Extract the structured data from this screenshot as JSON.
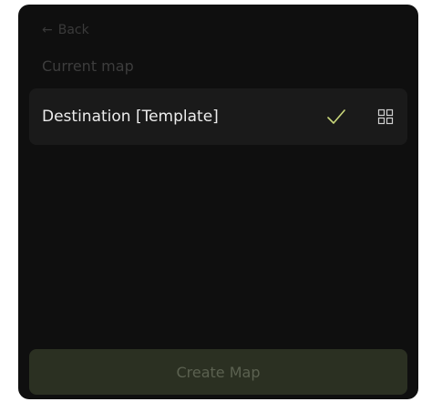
{
  "nav": {
    "back_arrow": "←",
    "back_label": "Back"
  },
  "section": {
    "title": "Current map"
  },
  "maps": [
    {
      "name": "Destination [Template]",
      "selected": true,
      "check_icon": "check-icon",
      "action_icon": "grid-icon"
    }
  ],
  "footer": {
    "create_label": "Create Map"
  },
  "colors": {
    "panel_bg": "#0f0f0f",
    "row_bg": "#1a1a1a",
    "accent_check": "#c8d67a",
    "button_bg": "#2b3022",
    "button_text": "#5b6150",
    "muted_text": "#3d3d3d"
  }
}
